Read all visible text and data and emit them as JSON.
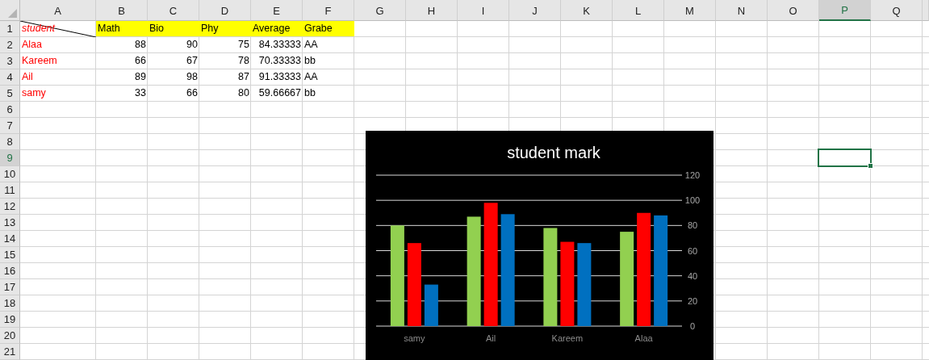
{
  "columns": [
    {
      "label": "A",
      "selected": false
    },
    {
      "label": "B",
      "selected": false
    },
    {
      "label": "C",
      "selected": false
    },
    {
      "label": "D",
      "selected": false
    },
    {
      "label": "E",
      "selected": false
    },
    {
      "label": "F",
      "selected": false
    },
    {
      "label": "G",
      "selected": false
    },
    {
      "label": "H",
      "selected": false
    },
    {
      "label": "I",
      "selected": false
    },
    {
      "label": "J",
      "selected": false
    },
    {
      "label": "K",
      "selected": false
    },
    {
      "label": "L",
      "selected": false
    },
    {
      "label": "M",
      "selected": false
    },
    {
      "label": "N",
      "selected": false
    },
    {
      "label": "O",
      "selected": false
    },
    {
      "label": "P",
      "selected": true
    },
    {
      "label": "Q",
      "selected": false
    }
  ],
  "rows": [
    {
      "label": "1",
      "selected": false,
      "cells": [
        {
          "text": "student",
          "kind": "corner"
        },
        {
          "text": "Math",
          "kind": "header"
        },
        {
          "text": "Bio",
          "kind": "header"
        },
        {
          "text": "Phy",
          "kind": "header"
        },
        {
          "text": "Average",
          "kind": "header"
        },
        {
          "text": "Grabe",
          "kind": "header"
        }
      ]
    },
    {
      "label": "2",
      "selected": false,
      "cells": [
        {
          "text": "Alaa",
          "kind": "name"
        },
        {
          "text": "88",
          "kind": "number"
        },
        {
          "text": "90",
          "kind": "number"
        },
        {
          "text": "75",
          "kind": "number"
        },
        {
          "text": "84.33333",
          "kind": "number"
        },
        {
          "text": "AA",
          "kind": "text"
        }
      ]
    },
    {
      "label": "3",
      "selected": false,
      "cells": [
        {
          "text": "Kareem",
          "kind": "name"
        },
        {
          "text": "66",
          "kind": "number"
        },
        {
          "text": "67",
          "kind": "number"
        },
        {
          "text": "78",
          "kind": "number"
        },
        {
          "text": "70.33333",
          "kind": "number"
        },
        {
          "text": "bb",
          "kind": "text"
        }
      ]
    },
    {
      "label": "4",
      "selected": false,
      "cells": [
        {
          "text": "Ail",
          "kind": "name"
        },
        {
          "text": "89",
          "kind": "number"
        },
        {
          "text": "98",
          "kind": "number"
        },
        {
          "text": "87",
          "kind": "number"
        },
        {
          "text": "91.33333",
          "kind": "number"
        },
        {
          "text": "AA",
          "kind": "text"
        }
      ]
    },
    {
      "label": "5",
      "selected": false,
      "cells": [
        {
          "text": "samy",
          "kind": "name"
        },
        {
          "text": "33",
          "kind": "number"
        },
        {
          "text": "66",
          "kind": "number"
        },
        {
          "text": "80",
          "kind": "number"
        },
        {
          "text": "59.66667",
          "kind": "number"
        },
        {
          "text": "bb",
          "kind": "text"
        }
      ]
    },
    {
      "label": "6",
      "selected": false
    },
    {
      "label": "7",
      "selected": false
    },
    {
      "label": "8",
      "selected": false
    },
    {
      "label": "9",
      "selected": true
    },
    {
      "label": "10",
      "selected": false
    },
    {
      "label": "11",
      "selected": false
    },
    {
      "label": "12",
      "selected": false
    },
    {
      "label": "13",
      "selected": false
    },
    {
      "label": "14",
      "selected": false
    },
    {
      "label": "15",
      "selected": false
    },
    {
      "label": "16",
      "selected": false
    },
    {
      "label": "17",
      "selected": false
    },
    {
      "label": "18",
      "selected": false
    },
    {
      "label": "19",
      "selected": false
    },
    {
      "label": "20",
      "selected": false
    },
    {
      "label": "21",
      "selected": false
    }
  ],
  "chart": {
    "chart_data": {
      "type": "bar",
      "title": "student mark",
      "categories": [
        "samy",
        "Ail",
        "Kareem",
        "Alaa"
      ],
      "series": [
        {
          "color": "#92d050",
          "values": [
            80,
            87,
            78,
            75
          ]
        },
        {
          "color": "#ff0000",
          "values": [
            66,
            98,
            67,
            90
          ]
        },
        {
          "color": "#0070c0",
          "values": [
            33,
            89,
            66,
            88
          ]
        }
      ],
      "grid": true,
      "ylim": [
        0,
        120
      ],
      "yticks": [
        0,
        20,
        40,
        60,
        80,
        100,
        120
      ]
    }
  }
}
